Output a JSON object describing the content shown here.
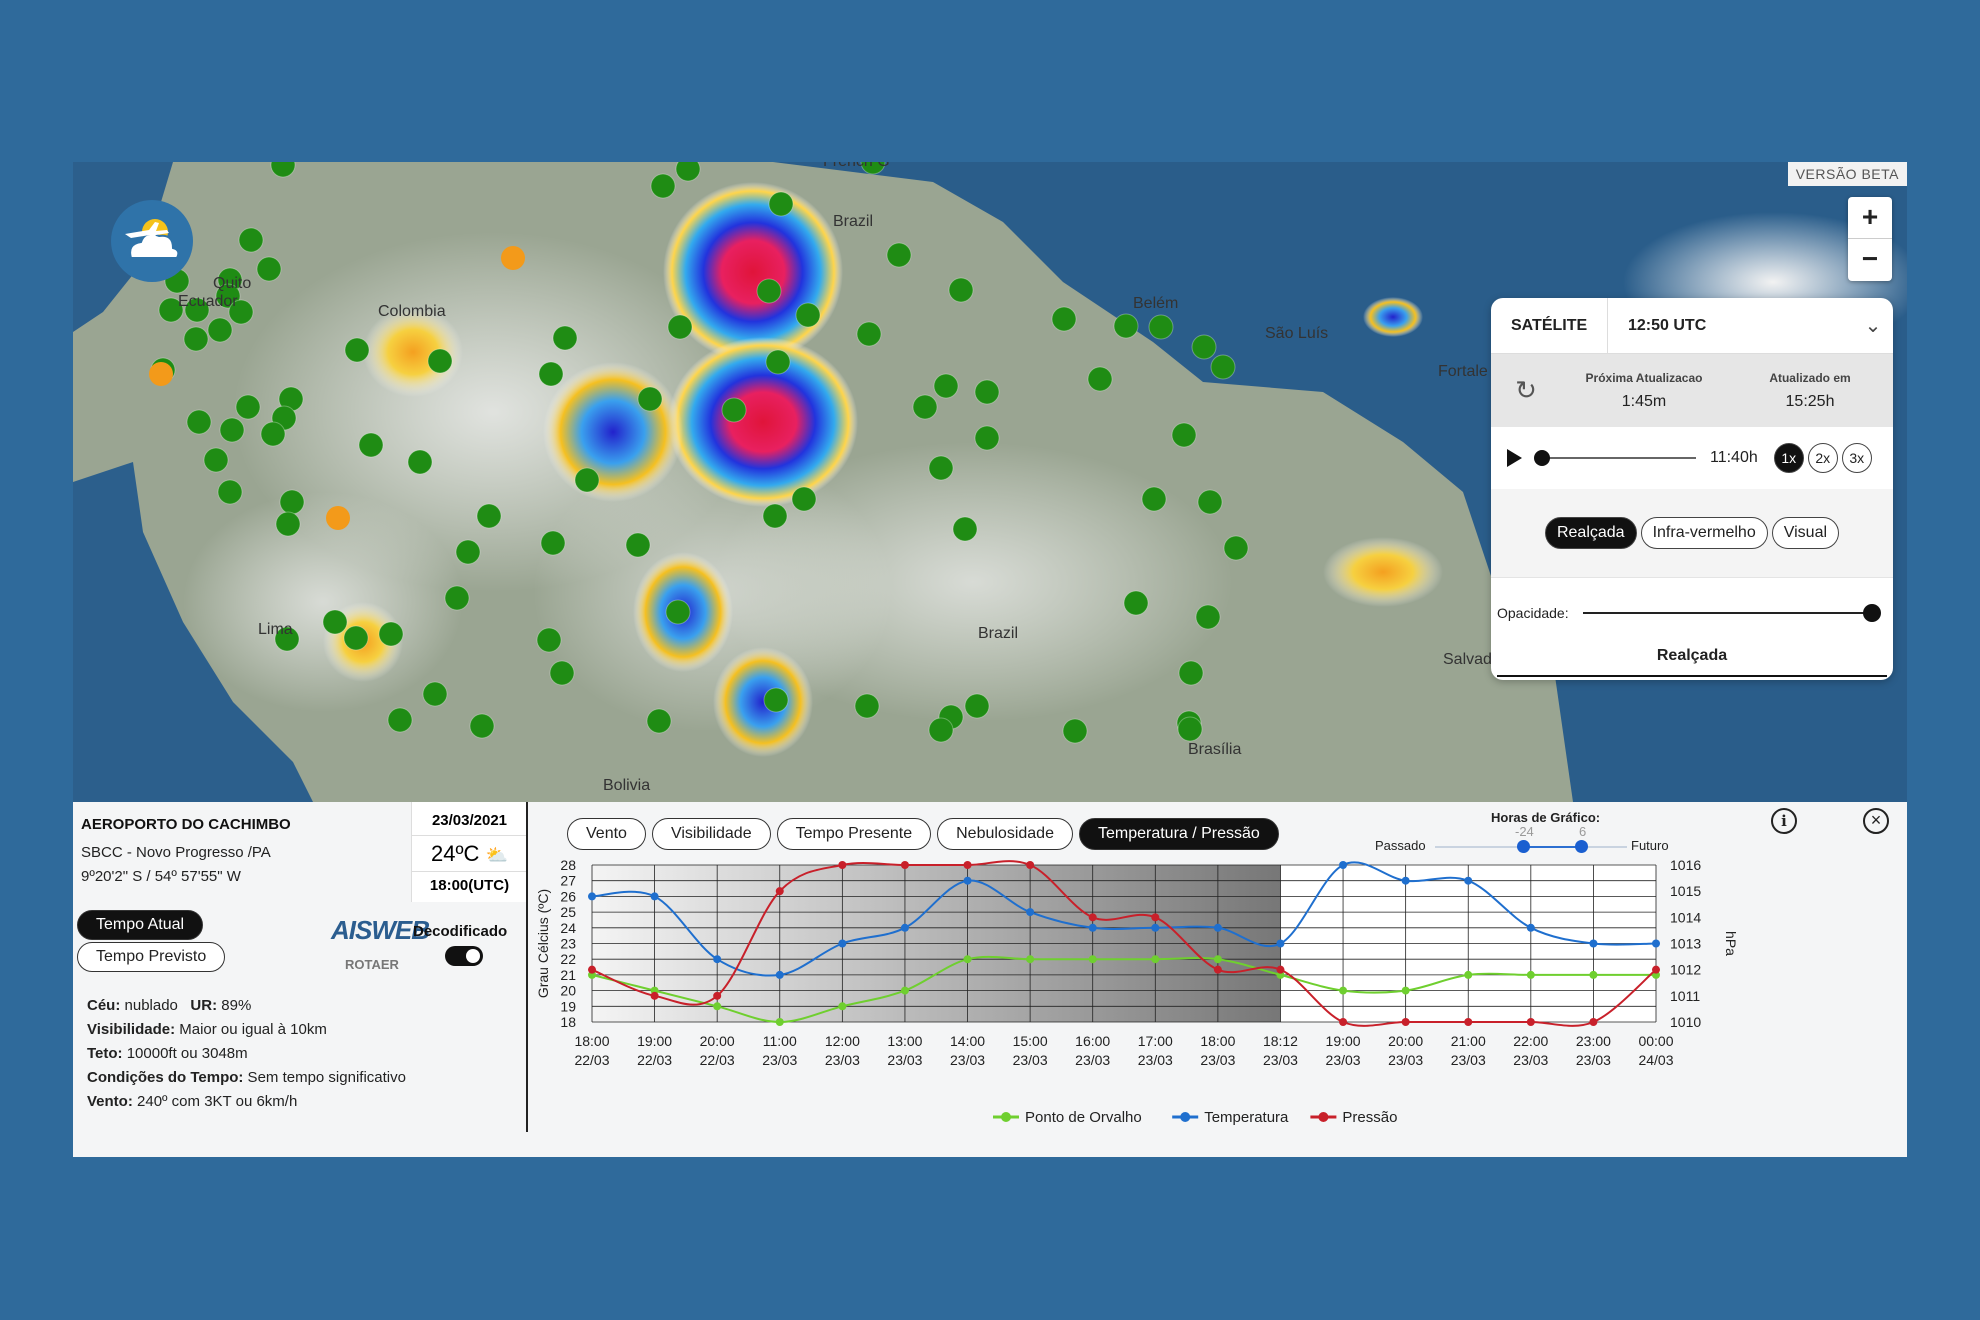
{
  "map": {
    "beta_label": "VERSÃO BETA",
    "zoom_in": "+",
    "zoom_out": "−",
    "place_labels": [
      "French G",
      "Brazil",
      "Quito",
      "Ecuador",
      "Colombia",
      "Belém",
      "São Luís",
      "Fortale",
      "Brazil",
      "Lima",
      "Bolivia",
      "Brasília",
      "Salvad"
    ]
  },
  "satellite": {
    "title": "SATÉLITE",
    "time": "12:50 UTC",
    "next_update_label": "Próxima Atualizacao",
    "next_update_value": "1:45m",
    "updated_label": "Atualizado em",
    "updated_value": "15:25h",
    "playback_time": "11:40h",
    "speeds": [
      "1x",
      "2x",
      "3x"
    ],
    "modes": [
      "Realçada",
      "Infra-vermelho",
      "Visual"
    ],
    "opacity_label": "Opacidade:",
    "opacity_value": 1.0,
    "layer_label": "Realçada"
  },
  "station": {
    "name": "AEROPORTO DO CACHIMBO",
    "code_city": "SBCC - Novo Progresso /PA",
    "coords": "9º20'2\" S / 54º 57'55\" W",
    "date": "23/03/2021",
    "temperature": "24ºC",
    "time": "18:00(UTC)",
    "tab_current": "Tempo Atual",
    "tab_forecast": "Tempo Previsto",
    "brand": "AISWEB",
    "rotaer": "ROTAER",
    "decoded_label": "Decodificado",
    "sky_label": "Céu:",
    "sky_value": " nublado",
    "ur_label": "UR:",
    "ur_value": " 89%",
    "visibility_label": "Visibilidade:",
    "visibility_value": " Maior ou igual à 10km",
    "ceiling_label": "Teto:",
    "ceiling_value": " 10000ft ou 3048m",
    "conditions_label": "Condições do Tempo:",
    "conditions_value": " Sem tempo significativo",
    "wind_label": "Vento:",
    "wind_value": " 240º com 3KT ou 6km/h"
  },
  "chart_tabs": [
    "Vento",
    "Visibilidade",
    "Tempo Presente",
    "Nebulosidade",
    "Temperatura / Pressão"
  ],
  "chart_tabs_active": 4,
  "hours_control": {
    "title": "Horas de Gráfico:",
    "past_label": "Passado",
    "future_label": "Futuro",
    "past_value": "-24",
    "future_value": "6"
  },
  "colors": {
    "dew": "#6fcf2f",
    "temp": "#1f6fce",
    "pressure": "#c8202a"
  },
  "chart_data": {
    "type": "line",
    "ylabel": "Grau Célcius (ºC)",
    "y2label": "hPa",
    "ylim": [
      18,
      28
    ],
    "y2lim": [
      1010,
      1016
    ],
    "yticks": [
      "28",
      "27",
      "26",
      "25",
      "24",
      "23",
      "22",
      "21",
      "20",
      "19",
      "18"
    ],
    "y2ticks": [
      "1016",
      "1015",
      "1014",
      "1013",
      "1012",
      "1011",
      "1010"
    ],
    "x": [
      "18:00\n22/03",
      "19:00\n22/03",
      "20:00\n22/03",
      "11:00\n23/03",
      "12:00\n23/03",
      "13:00\n23/03",
      "14:00\n23/03",
      "15:00\n23/03",
      "16:00\n23/03",
      "17:00\n23/03",
      "18:00\n23/03",
      "18:12\n23/03",
      "19:00\n23/03",
      "20:00\n23/03",
      "21:00\n23/03",
      "22:00\n23/03",
      "23:00\n23/03",
      "00:00\n24/03"
    ],
    "series": [
      {
        "name": "Ponto de Orvalho",
        "axis": "left",
        "values": [
          21,
          20,
          19,
          18,
          19,
          20,
          22,
          22,
          22,
          22,
          22,
          21,
          20,
          20,
          21,
          21,
          21,
          21
        ]
      },
      {
        "name": "Temperatura",
        "axis": "left",
        "values": [
          26,
          26,
          22,
          21,
          23,
          24,
          27,
          25,
          24,
          24,
          24,
          23,
          28,
          27,
          27,
          24,
          23,
          23
        ]
      },
      {
        "name": "Pressão",
        "axis": "right",
        "values": [
          1012,
          1011,
          1011,
          1015,
          1016,
          1016,
          1016,
          1016,
          1014,
          1014,
          1012,
          1012,
          1010,
          1010,
          1010,
          1010,
          1010,
          1012
        ]
      }
    ],
    "shaded_until_index": 11,
    "legend_position": "bottom"
  }
}
